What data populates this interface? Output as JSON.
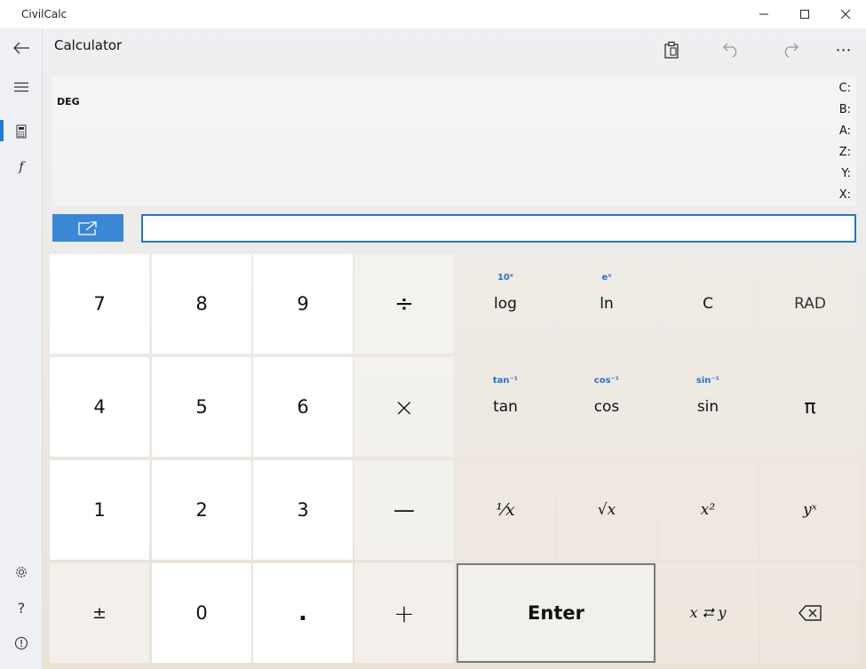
{
  "window": {
    "title": "CivilCalc"
  },
  "nav": {
    "back_icon": "arrow-left-icon",
    "items": [
      {
        "name": "hamburger-menu-icon"
      },
      {
        "name": "calculator-icon",
        "active": true
      },
      {
        "name": "function-icon",
        "label": "f"
      }
    ],
    "bottom": [
      {
        "name": "gear-icon"
      },
      {
        "name": "help-icon",
        "label": "?"
      },
      {
        "name": "info-icon"
      }
    ]
  },
  "header": {
    "title": "Calculator",
    "tools": [
      "clipboard-icon",
      "undo-icon",
      "redo-icon",
      "more-icon"
    ],
    "more_label": "⋯"
  },
  "stack": {
    "mode": "DEG",
    "registers": [
      "C:",
      "B:",
      "A:",
      "Z:",
      "Y:",
      "X:"
    ]
  },
  "input": {
    "value": "",
    "popout_icon": "popout-icon"
  },
  "keypad": {
    "row1": [
      {
        "label": "7",
        "kind": "num"
      },
      {
        "label": "8",
        "kind": "num"
      },
      {
        "label": "9",
        "kind": "num"
      },
      {
        "label": "÷",
        "kind": "op"
      },
      {
        "label": "log",
        "sup": "10ˣ",
        "kind": "fn"
      },
      {
        "label": "ln",
        "sup": "eˣ",
        "kind": "fn"
      },
      {
        "label": "C",
        "kind": "fn"
      },
      {
        "label": "RAD",
        "kind": "fn"
      }
    ],
    "row2": [
      {
        "label": "4",
        "kind": "num"
      },
      {
        "label": "5",
        "kind": "num"
      },
      {
        "label": "6",
        "kind": "num"
      },
      {
        "label": "×",
        "kind": "op"
      },
      {
        "label": "tan",
        "sup": "tan⁻¹",
        "kind": "fn"
      },
      {
        "label": "cos",
        "sup": "cos⁻¹",
        "kind": "fn"
      },
      {
        "label": "sin",
        "sup": "sin⁻¹",
        "kind": "fn"
      },
      {
        "label": "π",
        "kind": "fn"
      }
    ],
    "row3": [
      {
        "label": "1",
        "kind": "num"
      },
      {
        "label": "2",
        "kind": "num"
      },
      {
        "label": "3",
        "kind": "num"
      },
      {
        "label": "—",
        "kind": "op"
      },
      {
        "label": "¹⁄x",
        "kind": "fn"
      },
      {
        "label": "√x",
        "kind": "fn"
      },
      {
        "label": "x²",
        "kind": "fn"
      },
      {
        "label": "yˣ",
        "kind": "fn"
      }
    ],
    "row4": [
      {
        "label": "±",
        "kind": "op"
      },
      {
        "label": "0",
        "kind": "num"
      },
      {
        "label": ".",
        "kind": "num"
      },
      {
        "label": "+",
        "kind": "op"
      },
      {
        "label": "Enter",
        "kind": "enter"
      },
      {
        "label": "x ⮂ y",
        "kind": "fn"
      },
      {
        "label": "backspace-icon",
        "kind": "fn"
      }
    ]
  }
}
